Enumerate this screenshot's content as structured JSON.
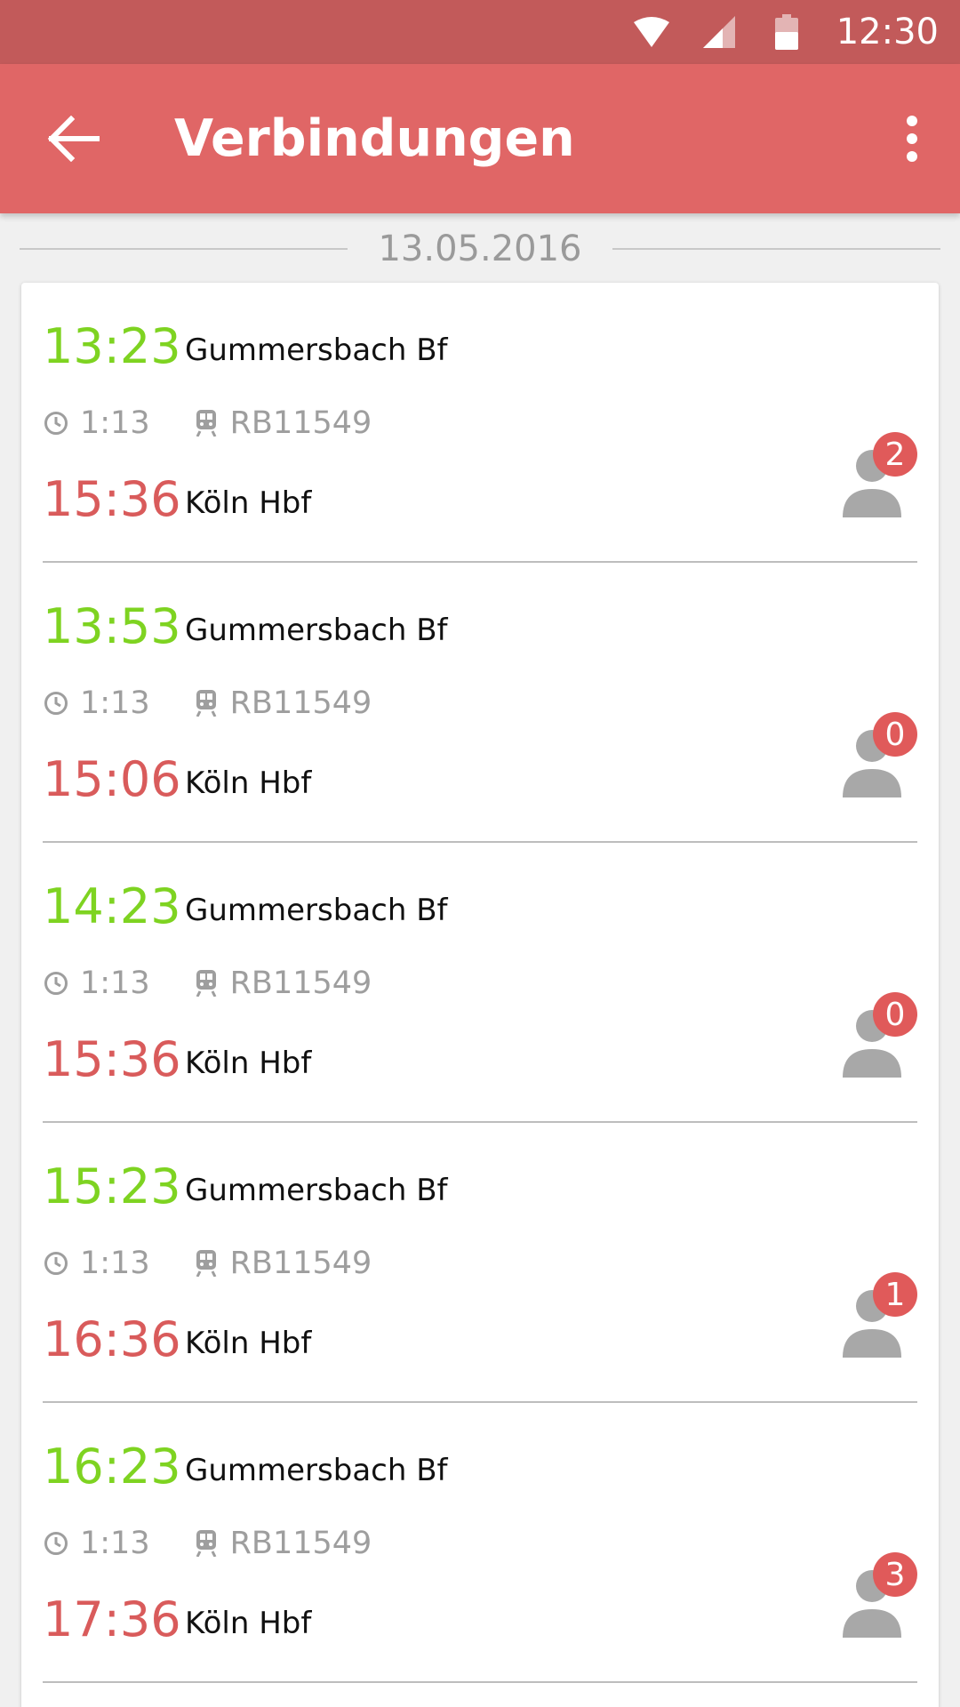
{
  "status_bar": {
    "time": "12:30",
    "icons": [
      "wifi-icon",
      "signal-icon",
      "battery-icon"
    ]
  },
  "app_bar": {
    "title": "Verbindungen",
    "back_icon": "arrow-left-icon",
    "menu_icon": "more-vert-icon"
  },
  "date": "13.05.2016",
  "colors": {
    "app_bar": "#e06666",
    "status_bar": "#c25a5a",
    "departure": "#7ed321",
    "arrival": "#d95b5b",
    "badge": "#e05a5a"
  },
  "connections": [
    {
      "dep_time": "13:23",
      "dep_station": "Gummersbach Bf",
      "duration": "1:13",
      "train": "RB11549",
      "arr_time": "15:36",
      "arr_station": "Köln Hbf",
      "passengers": "2"
    },
    {
      "dep_time": "13:53",
      "dep_station": "Gummersbach Bf",
      "duration": "1:13",
      "train": "RB11549",
      "arr_time": "15:06",
      "arr_station": "Köln Hbf",
      "passengers": "0"
    },
    {
      "dep_time": "14:23",
      "dep_station": "Gummersbach Bf",
      "duration": "1:13",
      "train": "RB11549",
      "arr_time": "15:36",
      "arr_station": "Köln Hbf",
      "passengers": "0"
    },
    {
      "dep_time": "15:23",
      "dep_station": "Gummersbach Bf",
      "duration": "1:13",
      "train": "RB11549",
      "arr_time": "16:36",
      "arr_station": "Köln Hbf",
      "passengers": "1"
    },
    {
      "dep_time": "16:23",
      "dep_station": "Gummersbach Bf",
      "duration": "1:13",
      "train": "RB11549",
      "arr_time": "17:36",
      "arr_station": "Köln Hbf",
      "passengers": "3"
    }
  ]
}
